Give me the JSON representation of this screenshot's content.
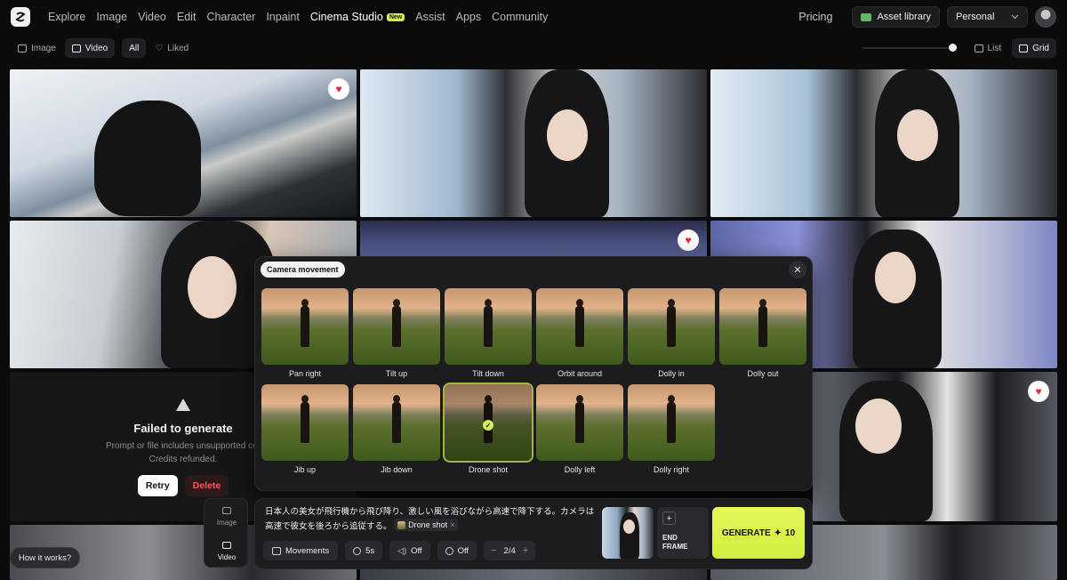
{
  "nav": {
    "items": [
      {
        "label": "Explore"
      },
      {
        "label": "Image"
      },
      {
        "label": "Video"
      },
      {
        "label": "Edit"
      },
      {
        "label": "Character"
      },
      {
        "label": "Inpaint"
      },
      {
        "label": "Cinema Studio",
        "badge": "New"
      },
      {
        "label": "Assist"
      },
      {
        "label": "Apps"
      },
      {
        "label": "Community"
      }
    ],
    "pricing": "Pricing",
    "asset_library": "Asset library",
    "workspace": "Personal"
  },
  "filters": {
    "image": "Image",
    "video": "Video",
    "all": "All",
    "liked": "Liked",
    "list": "List",
    "grid": "Grid"
  },
  "failed_card": {
    "title": "Failed to generate",
    "message": "Prompt or file includes unsupported cor",
    "refund": "Credits refunded.",
    "retry": "Retry",
    "delete": "Delete"
  },
  "panel": {
    "title": "Camera movement",
    "close": "✕",
    "movements": [
      {
        "label": "Pan right"
      },
      {
        "label": "Tilt up"
      },
      {
        "label": "Tilt down"
      },
      {
        "label": "Orbit around"
      },
      {
        "label": "Dolly in"
      },
      {
        "label": "Dolly out"
      },
      {
        "label": "Jib up"
      },
      {
        "label": "Jib down"
      },
      {
        "label": "Drone shot",
        "selected": true
      },
      {
        "label": "Dolly left"
      },
      {
        "label": "Dolly right"
      }
    ]
  },
  "modes": {
    "image": "Image",
    "video": "Video"
  },
  "prompt": {
    "text": "日本人の美女が飛行機から飛び降り、激しい風を浴びながら高速で降下する。カメラは高速で彼女を後ろから追従する。",
    "chip": "Drone shot",
    "chip_remove": "×",
    "movements_btn": "Movements",
    "duration": "5s",
    "audio": "Off",
    "enhance": "Off",
    "count": "2/4",
    "minus": "−",
    "plus": "+",
    "end_frame_plus": "+",
    "end_frame": "END FRAME",
    "generate": "GENERATE",
    "cost": "10",
    "generate_icon": "✦"
  },
  "help": "How it works?",
  "icons": {
    "heart": "♥",
    "check": "✓"
  },
  "colors": {
    "accent": "#d7f05a",
    "heart": "#e52733",
    "delete": "#ff5757"
  }
}
